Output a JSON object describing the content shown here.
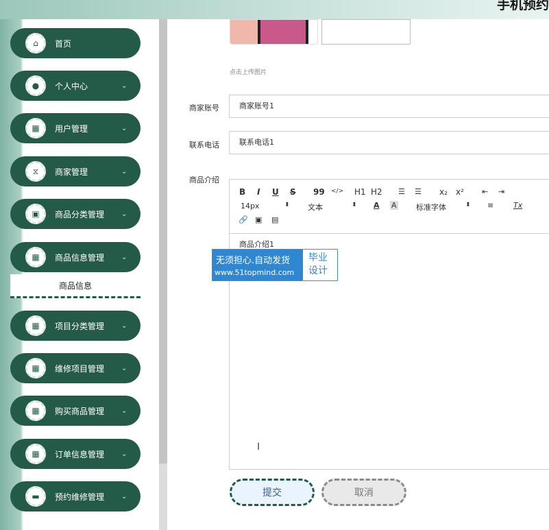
{
  "header": {
    "title": "手机预约"
  },
  "sidebar": {
    "items": [
      {
        "label": "首页",
        "icon": "home-icon",
        "glyph": "⌂",
        "chevron": ""
      },
      {
        "label": "个人中心",
        "icon": "user-icon",
        "glyph": "●",
        "chevron": "⌄"
      },
      {
        "label": "用户管理",
        "icon": "grid-icon",
        "glyph": "▦",
        "chevron": "⌄"
      },
      {
        "label": "商家管理",
        "icon": "store-icon",
        "glyph": "⧖",
        "chevron": "⌄"
      },
      {
        "label": "商品分类管理",
        "icon": "category-icon",
        "glyph": "▣",
        "chevron": "⌄"
      },
      {
        "label": "商品信息管理",
        "icon": "grid-icon",
        "glyph": "▦",
        "chevron": "⌄"
      },
      {
        "label": "项目分类管理",
        "icon": "grid-icon",
        "glyph": "▦",
        "chevron": "⌄"
      },
      {
        "label": "维修项目管理",
        "icon": "grid-icon",
        "glyph": "▦",
        "chevron": "⌄"
      },
      {
        "label": "购买商品管理",
        "icon": "grid-icon",
        "glyph": "▦",
        "chevron": "⌄"
      },
      {
        "label": "订单信息管理",
        "icon": "grid-icon",
        "glyph": "▦",
        "chevron": "⌄"
      },
      {
        "label": "预约维修管理",
        "icon": "briefcase-icon",
        "glyph": "▬",
        "chevron": "⌄"
      }
    ],
    "submenu": {
      "label": "商品信息"
    }
  },
  "form": {
    "upload_hint": "点击上传图片",
    "merchant_account": {
      "label": "商家账号",
      "value": "商家账号1"
    },
    "phone": {
      "label": "联系电话",
      "value": "联系电话1"
    },
    "intro": {
      "label": "商品介绍",
      "content": "商品介绍1"
    }
  },
  "editor_toolbar": {
    "bold": "B",
    "italic": "I",
    "underline": "U",
    "strike": "S",
    "quote": "99",
    "code": "</>",
    "h1": "H1",
    "h2": "H2",
    "ordered_list": "☰",
    "bullet_list": "☰",
    "subscript": "x₂",
    "superscript": "x²",
    "outdent": "⇤",
    "indent": "⇥",
    "font_size": "14px",
    "text_style": "文本",
    "font_color": "A",
    "bg_color": "A",
    "font_family": "标准字体",
    "align": "≡",
    "clear_format": "Tx",
    "link": "🔗",
    "image": "▣",
    "video": "▤"
  },
  "watermark": {
    "line1": "无须担心.自动发货",
    "line2": "www.51topmind.com",
    "right": "毕业设计"
  },
  "buttons": {
    "submit": "提交",
    "cancel": "取消"
  }
}
